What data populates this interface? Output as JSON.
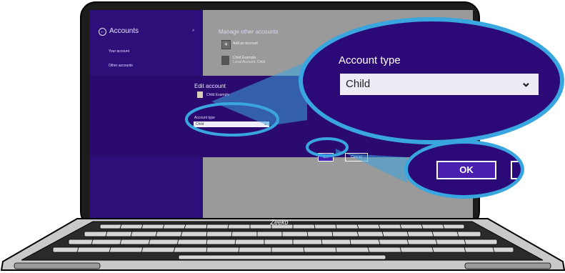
{
  "sidebar": {
    "title": "Accounts",
    "items": [
      "Your account",
      "Other accounts"
    ]
  },
  "content": {
    "heading": "Manage other accounts",
    "add_account": "Add an account",
    "child_name": "Child Example",
    "child_sub": "Local Account, Child"
  },
  "dialog": {
    "title": "Edit account",
    "user_name": "Child Example",
    "account_type_label": "Account type",
    "account_type_value": "Child",
    "ok_label": "OK",
    "cancel_label": "Cancel"
  },
  "callout": {
    "account_type_label": "Account type",
    "account_type_value": "Child",
    "ok_label": "OK"
  },
  "brand": "Zeeko",
  "colors": {
    "sidebar": "#2d0f7a",
    "dialog": "#2a0a6e",
    "highlight_ring": "#3aa6e0",
    "ok_button": "#4a1fb0"
  }
}
